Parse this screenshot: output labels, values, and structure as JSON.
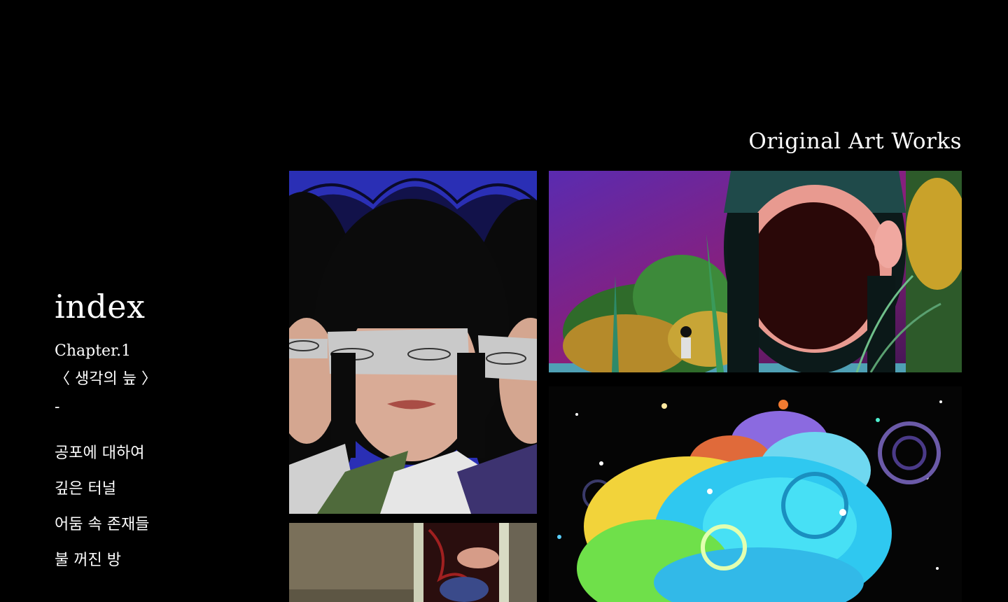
{
  "header": {
    "title": "Original Art Works"
  },
  "sidebar": {
    "title": "index",
    "chapter": "Chapter.1",
    "chapter_subtitle": "〈 생각의 늪 〉",
    "separator": "-",
    "items": [
      {
        "label": "공포에 대하여"
      },
      {
        "label": "깊은 터널"
      },
      {
        "label": "어둠 속 존재들"
      },
      {
        "label": "불 꺼진 방"
      }
    ]
  },
  "gallery": {
    "artworks": [
      {
        "name": "artwork-masked-girls"
      },
      {
        "name": "artwork-faceless-girl-forest"
      },
      {
        "name": "artwork-colorful-cosmic-swirl"
      },
      {
        "name": "artwork-dark-room"
      }
    ]
  },
  "colors": {
    "background": "#000000",
    "text": "#ffffff"
  }
}
